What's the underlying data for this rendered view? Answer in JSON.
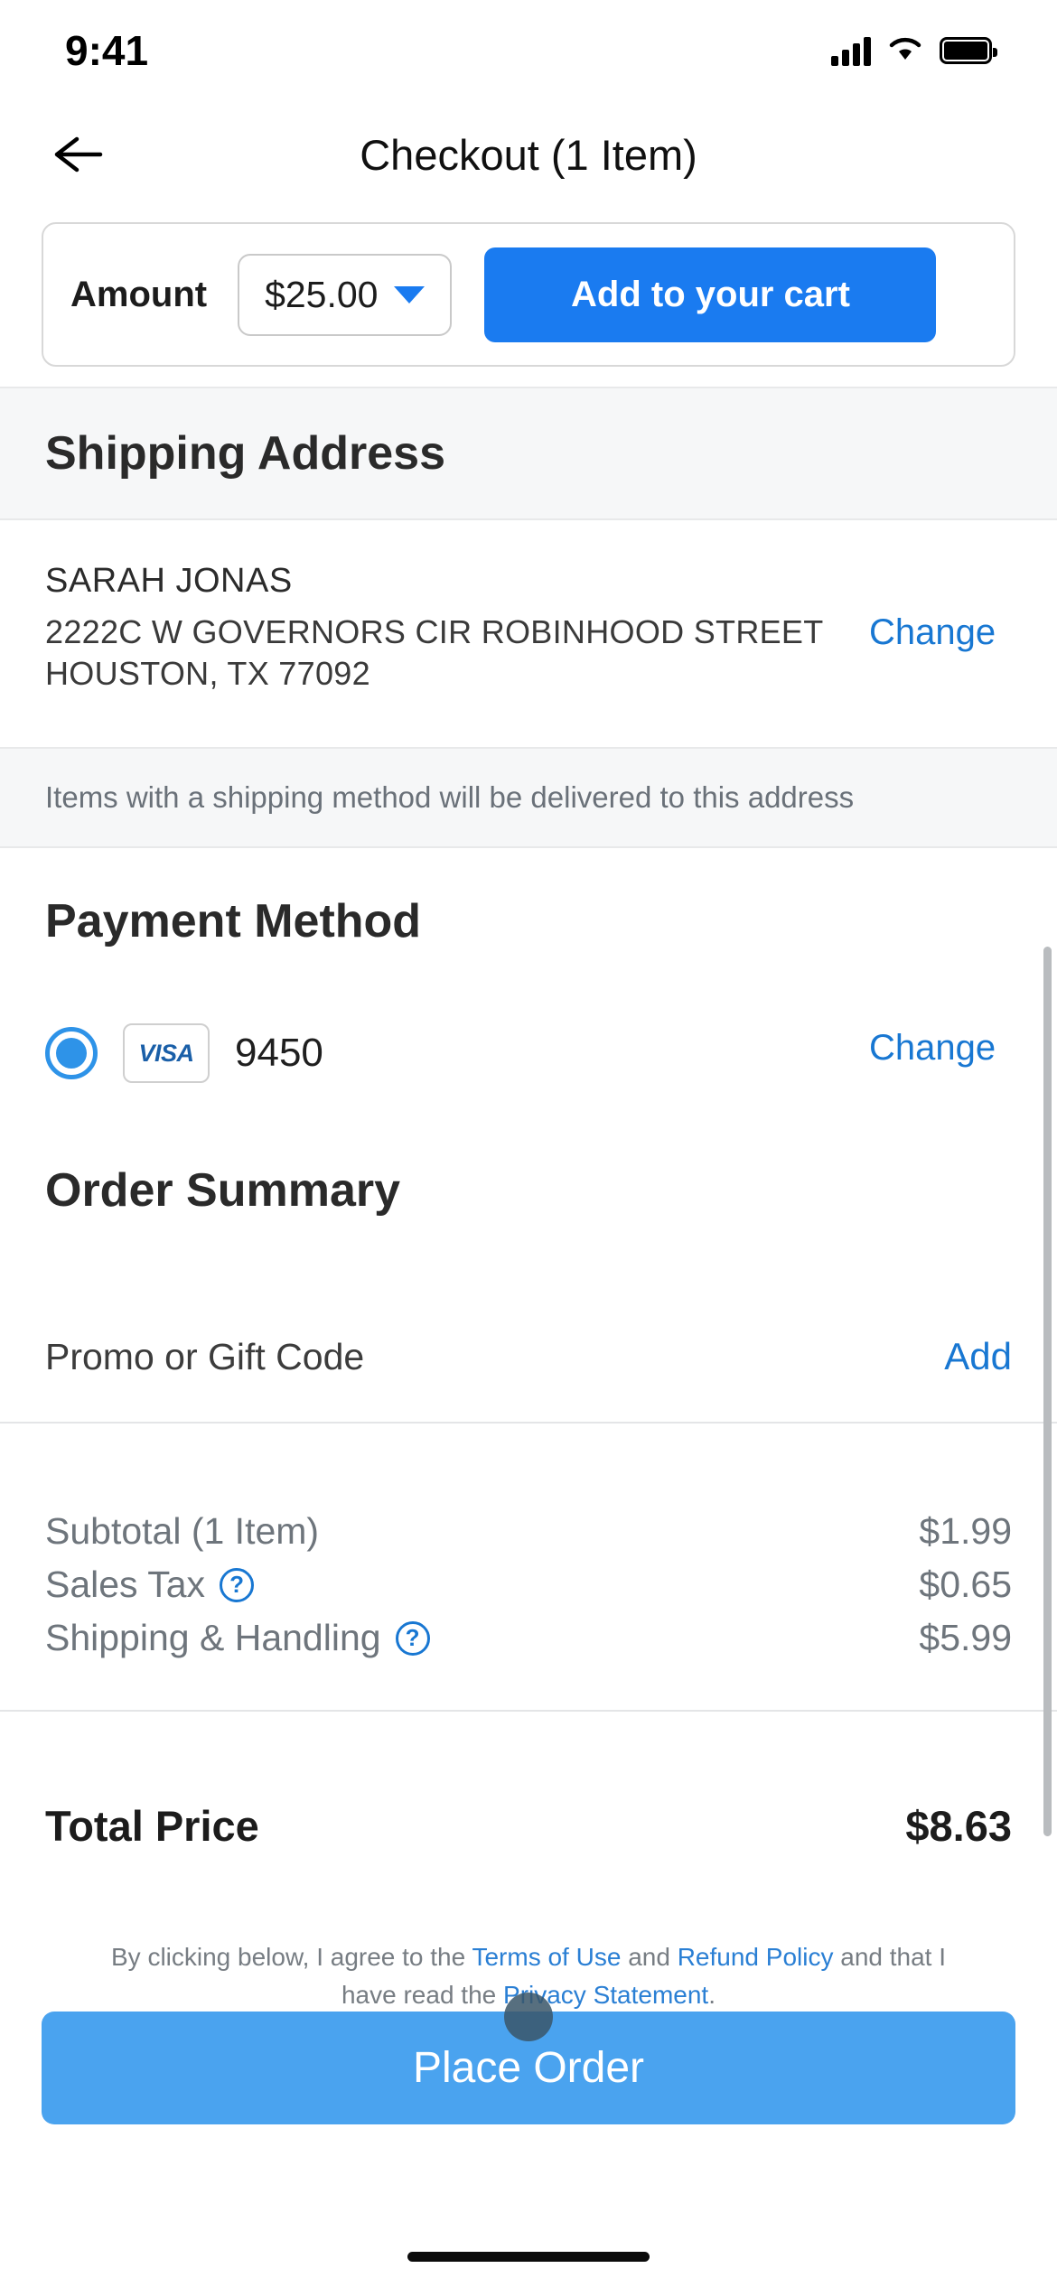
{
  "status_bar": {
    "time": "9:41",
    "signal_icon": "cellular-signal-icon",
    "wifi_icon": "wifi-icon",
    "battery_icon": "battery-full-icon"
  },
  "header": {
    "back_icon": "back-arrow-icon",
    "title": "Checkout (1 Item)"
  },
  "amount_card": {
    "label": "Amount",
    "selected_value": "$25.00",
    "caret_icon": "chevron-down-icon",
    "add_to_cart_label": "Add to your cart"
  },
  "shipping": {
    "section_title": "Shipping Address",
    "recipient_name": "SARAH JONAS",
    "street": "2222C W GOVERNORS CIR ROBINHOOD STREET",
    "city_state_zip": "HOUSTON, TX 77092",
    "change_label": "Change",
    "note": "Items with a shipping method will be delivered to this address"
  },
  "payment": {
    "section_title": "Payment Method",
    "selected": true,
    "card_brand": "VISA",
    "card_last4": "9450",
    "change_label": "Change"
  },
  "order_summary": {
    "section_title": "Order Summary",
    "promo_label": "Promo or Gift Code",
    "promo_add_label": "Add",
    "lines": [
      {
        "label": "Subtotal (1 Item)",
        "value": "$1.99",
        "has_help": false
      },
      {
        "label": "Sales Tax",
        "value": "$0.65",
        "has_help": true
      },
      {
        "label": "Shipping & Handling",
        "value": "$5.99",
        "has_help": true
      }
    ],
    "total_label": "Total Price",
    "total_value": "$8.63"
  },
  "footer": {
    "legal_prefix": "By clicking below, I agree to the ",
    "terms_link": "Terms of Use",
    "legal_mid": " and ",
    "refund_link": "Refund Policy",
    "legal_mid2": " and that I have read the ",
    "privacy_link": "Privacy Statement",
    "legal_suffix": ".",
    "place_order_label": "Place Order"
  },
  "colors": {
    "primary_blue": "#1a7bf0",
    "link_blue": "#1877d2",
    "place_order_blue": "#4aa3ef",
    "band_gray": "#f6f7f8",
    "muted_text": "#6e757c"
  }
}
